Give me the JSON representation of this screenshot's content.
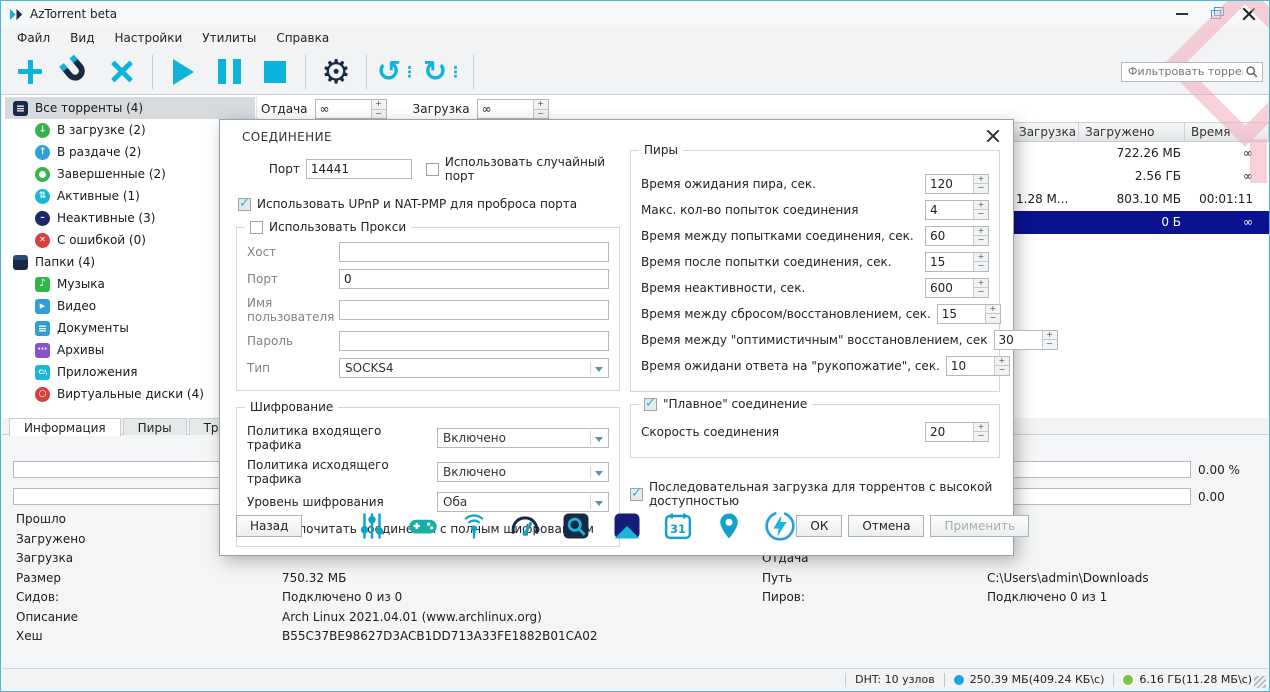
{
  "window": {
    "title": "AzTorrent beta"
  },
  "menu": {
    "items": [
      "Файл",
      "Вид",
      "Настройки",
      "Утилиты",
      "Справка"
    ]
  },
  "toolbar": {
    "filter_placeholder": "Фильтровать торренты"
  },
  "limits": {
    "upload_label": "Отдача",
    "upload_value": "∞",
    "download_label": "Загрузка",
    "download_value": "∞"
  },
  "ui": {
    "spin_up": "+",
    "spin_down": "−"
  },
  "sidebar": {
    "items": [
      {
        "label": "Все торренты (4)"
      },
      {
        "label": "В загрузке (2)"
      },
      {
        "label": "В раздаче (2)"
      },
      {
        "label": "Завершенные (2)"
      },
      {
        "label": "Активные (1)"
      },
      {
        "label": "Неактивные (3)"
      },
      {
        "label": "С ошибкой (0)"
      },
      {
        "label": "Папки (4)"
      },
      {
        "label": "Музыка"
      },
      {
        "label": "Видео"
      },
      {
        "label": "Документы"
      },
      {
        "label": "Архивы"
      },
      {
        "label": "Приложения"
      },
      {
        "label": "Виртуальные диски (4)"
      }
    ]
  },
  "tabs": {
    "items": [
      "Информация",
      "Пиры",
      "Тр"
    ]
  },
  "table": {
    "columns": [
      "Загрузка",
      "Загружено",
      "Время"
    ],
    "rows": [
      {
        "speed": "",
        "downloaded": "722.26 МБ",
        "time": "∞"
      },
      {
        "speed": "",
        "downloaded": "2.56 ГБ",
        "time": "∞"
      },
      {
        "speed": "1.28 М...",
        "downloaded": "803.10 МБ",
        "time": "00:01:11"
      },
      {
        "speed": "",
        "downloaded": "0 Б",
        "time": "∞"
      }
    ]
  },
  "details": {
    "progress_value": "0.00 %",
    "ratio_value": "0.00",
    "left_rows": [
      {
        "label": "Прошло",
        "value": ""
      },
      {
        "label": "Загружено",
        "value": ""
      },
      {
        "label": "Загрузка",
        "value": ""
      },
      {
        "label": "Размер",
        "value": "750.32 МБ"
      },
      {
        "label": "Сидов:",
        "value": "Подключено 0 из 0"
      },
      {
        "label": "Описание",
        "value": "Arch Linux 2021.04.01 (www.archlinux.org)"
      },
      {
        "label": "Хеш",
        "value": "B55C37BE98627D3ACB1DD713A33FE1882B01CA02"
      }
    ],
    "right_rows": [
      {
        "label": "Отдача",
        "value": ""
      },
      {
        "label": "Путь",
        "value": "C:\\Users\\admin\\Downloads"
      },
      {
        "label": "Пиров:",
        "value": "Подключено 0 из 1"
      }
    ]
  },
  "statusbar": {
    "dht": "DHT: 10 узлов",
    "net1": "250.39 МБ(409.24 КБ\\с)",
    "net2": "6.16 ГБ(11.28 МБ\\с)"
  },
  "dialog": {
    "title": "СОЕДИНЕНИЕ",
    "port_label": "Порт",
    "port_value": "14441",
    "random_port_label": "Использовать случайный порт",
    "upnp_label": "Использовать UPnP и NAT-PMP для проброса порта",
    "proxy": {
      "group_label": "Использовать Прокси",
      "host_label": "Хост",
      "host_value": "",
      "port_label": "Порт",
      "port_value": "0",
      "user_label": "Имя пользователя",
      "user_value": "",
      "password_label": "Пароль",
      "password_value": "",
      "type_label": "Тип",
      "type_value": "SOCKS4"
    },
    "encryption": {
      "group_label": "Шифрование",
      "in_label": "Политика входящего трафика",
      "in_value": "Включено",
      "out_label": "Политика исходящего трафика",
      "out_value": "Включено",
      "level_label": "Уровень шифрования",
      "level_value": "Оба",
      "prefer_label": "Предпочитать соединения с полным шифрованием"
    },
    "peers": {
      "group_label": "Пиры",
      "rows": [
        {
          "label": "Время ожидания пира, сек.",
          "value": "120"
        },
        {
          "label": "Макс. кол-во попыток соединения",
          "value": "4"
        },
        {
          "label": "Время между попытками соединения, сек.",
          "value": "60"
        },
        {
          "label": "Время после попытки соединения, сек.",
          "value": "15"
        },
        {
          "label": "Время неактивности, сек.",
          "value": "600"
        },
        {
          "label": "Время между сбросом/восстановлением, сек.",
          "value": "15"
        },
        {
          "label": "Время между \"оптимистичным\" восстановлением, сек",
          "value": "30"
        },
        {
          "label": "Время ожидани ответа на \"рукопожатие\", сек.",
          "value": "10"
        }
      ]
    },
    "smooth": {
      "group_label": "\"Плавное\" соединение",
      "speed_label": "Скорость соединения",
      "speed_value": "20"
    },
    "sequential_label": "Последовательная загрузка для торрентов с высокой доступностью",
    "back_button": "Назад",
    "ok_button": "ОК",
    "cancel_button": "Отмена",
    "apply_button": "Применить",
    "calendar_text": "31"
  }
}
